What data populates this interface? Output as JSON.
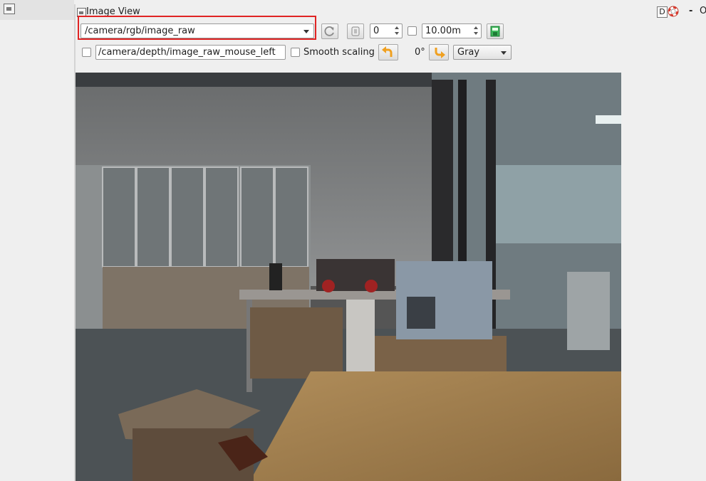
{
  "plugin": {
    "title": "Image View",
    "d_button_label": "D",
    "dash": "-",
    "o_label": "O"
  },
  "toolbar": {
    "topic": "/camera/rgb/image_raw",
    "zoom_value": "0",
    "max_range_value": "10.00m",
    "mouse_topic": "/camera/depth/image_raw_mouse_left",
    "smooth_scaling_label": "Smooth scaling",
    "rotation_label": "0°",
    "color_scheme": "Gray"
  },
  "icons": {
    "refresh": "refresh-icon",
    "pan": "hand-icon",
    "save": "save-image-icon",
    "rotate_left": "rotate-left-icon",
    "rotate_right": "rotate-right-icon",
    "help": "help-lifebuoy-icon"
  },
  "colors": {
    "highlight": "#e02424",
    "window_bg": "#efefef",
    "rotate_arrow": "#f0a020",
    "save_icon": "#2aa84a"
  },
  "image": {
    "description_label": "camera-feed"
  }
}
